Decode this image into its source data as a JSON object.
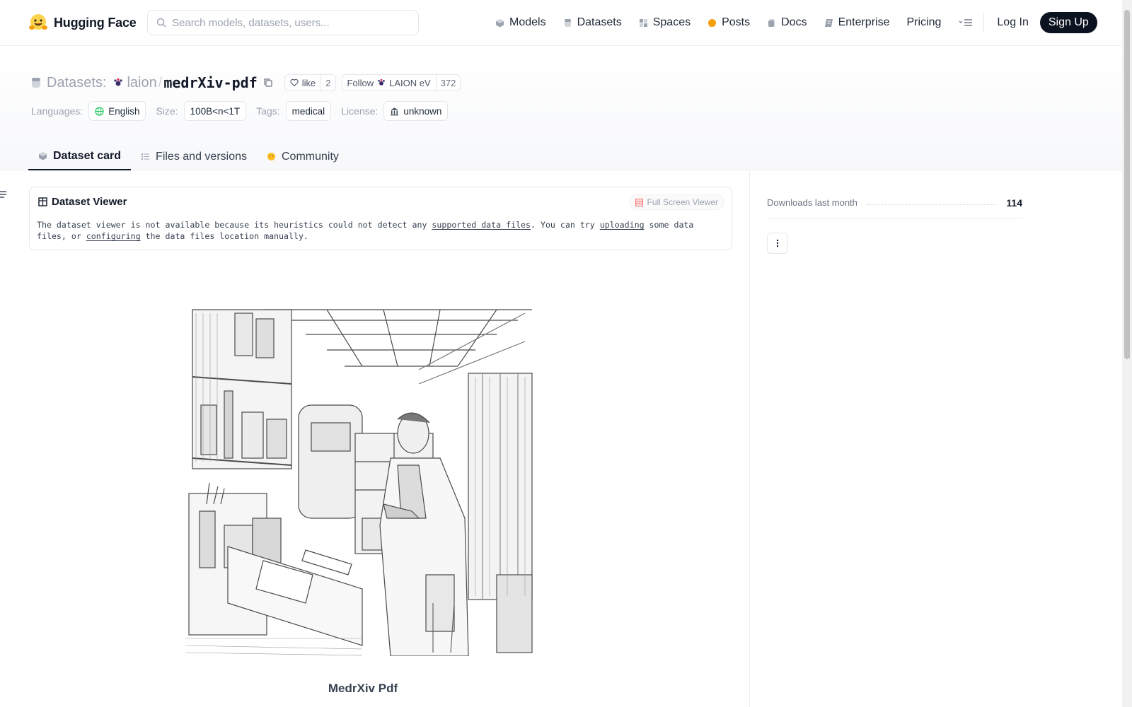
{
  "nav": {
    "brand": "Hugging Face",
    "search_placeholder": "Search models, datasets, users...",
    "items": [
      {
        "label": "Models",
        "icon": "models-icon"
      },
      {
        "label": "Datasets",
        "icon": "datasets-icon"
      },
      {
        "label": "Spaces",
        "icon": "spaces-icon"
      },
      {
        "label": "Posts",
        "icon": "posts-icon"
      },
      {
        "label": "Docs",
        "icon": "docs-icon"
      },
      {
        "label": "Enterprise",
        "icon": "enterprise-icon"
      },
      {
        "label": "Pricing",
        "icon": ""
      }
    ],
    "login": "Log In",
    "signup": "Sign Up"
  },
  "dataset": {
    "section_label": "Datasets:",
    "org": "laion",
    "separator": "/",
    "name": "medrXiv-pdf",
    "like_label": "like",
    "like_count": "2",
    "follow_label": "Follow",
    "follow_org": "LAION eV",
    "follow_count": "372"
  },
  "meta": {
    "languages_label": "Languages:",
    "language": "English",
    "size_label": "Size:",
    "size": "100B<n<1T",
    "tags_label": "Tags:",
    "tag": "medical",
    "license_label": "License:",
    "license": "unknown"
  },
  "tabs": [
    {
      "label": "Dataset card",
      "active": true
    },
    {
      "label": "Files and versions",
      "active": false
    },
    {
      "label": "Community",
      "active": false
    }
  ],
  "viewer": {
    "title": "Dataset Viewer",
    "fullscreen": "Full Screen Viewer",
    "msg_1": "The dataset viewer is not available because its heuristics could not detect any ",
    "link_1": "supported data files",
    "msg_2": ". You can try ",
    "link_2": "uploading",
    "msg_3": " some data files, or ",
    "link_3": "configuring",
    "msg_4": " the data files location manually."
  },
  "card": {
    "caption": "MedrXiv Pdf"
  },
  "sidebar": {
    "downloads_label": "Downloads last month",
    "downloads_count": "114"
  },
  "colors": {
    "brand_dark": "#0b1220",
    "accent_yellow": "#fbbf24",
    "border": "#e5e7eb"
  }
}
